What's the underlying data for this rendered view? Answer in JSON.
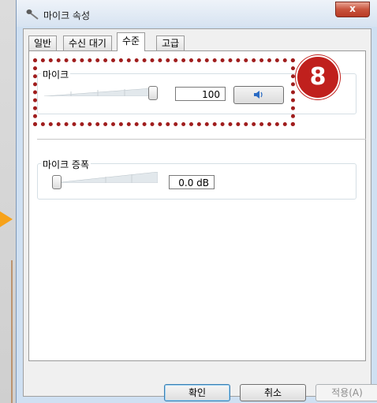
{
  "window": {
    "title": "마이크 속성",
    "close_label": "x"
  },
  "tabs": [
    {
      "label": "일반"
    },
    {
      "label": "수신 대기"
    },
    {
      "label": "수준"
    },
    {
      "label": "고급"
    }
  ],
  "mic": {
    "label": "마이크",
    "value": "100",
    "level_fraction": 1.0
  },
  "boost": {
    "label": "마이크 증폭",
    "value": "0.0 dB",
    "level_fraction": 0.0
  },
  "annotation": {
    "step": "8"
  },
  "footer": {
    "ok": "확인",
    "cancel": "취소",
    "apply": "적용(A)"
  }
}
